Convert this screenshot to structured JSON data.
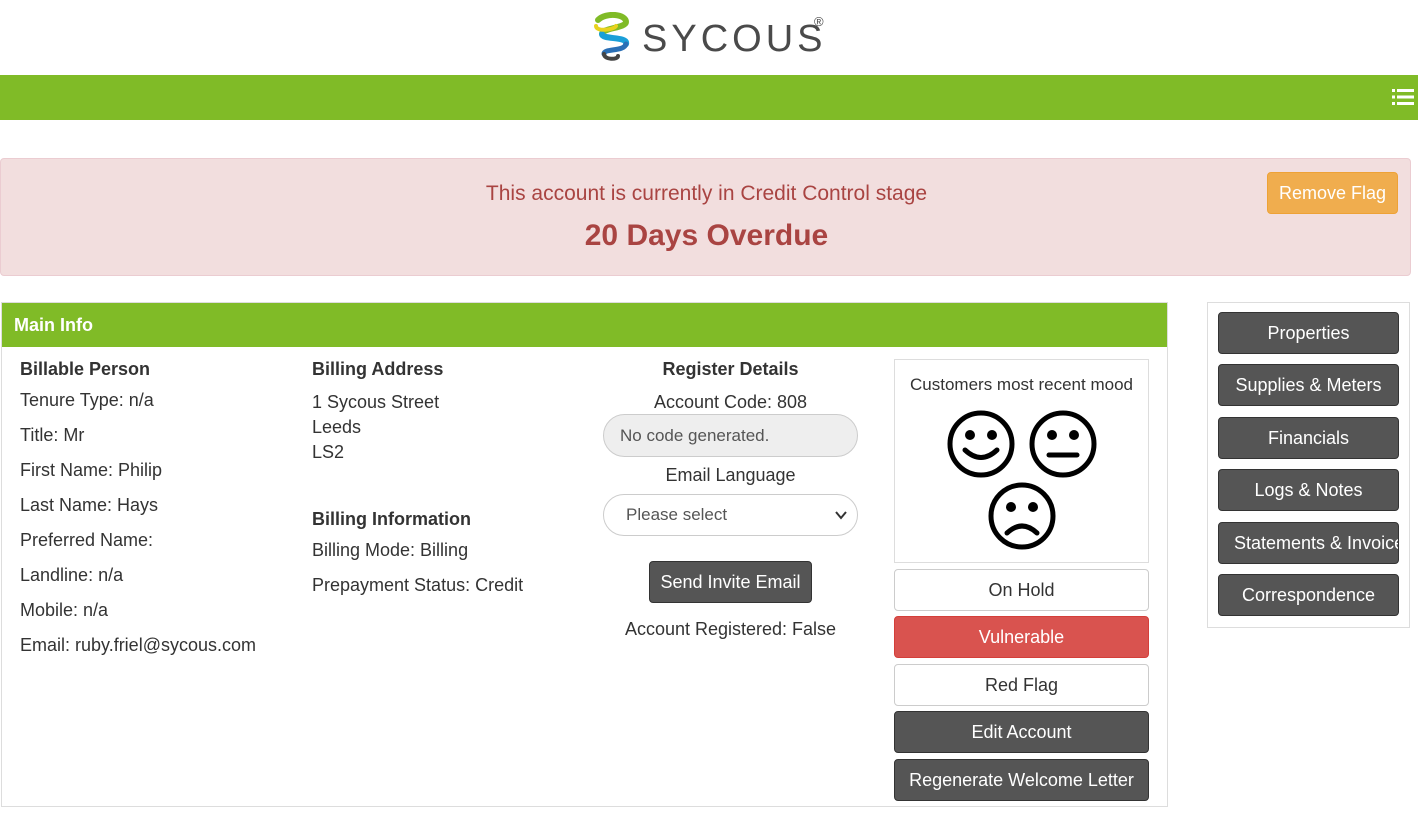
{
  "header": {
    "brand": "SYCOUS",
    "reg": "®",
    "brand_colors": {
      "navbar": "#80bb27"
    },
    "menu_icon": "list-icon"
  },
  "alert": {
    "subtitle": "This account is currently in Credit Control stage",
    "title": "20 Days Overdue",
    "remove_flag_label": "Remove Flag"
  },
  "main_info": {
    "heading": "Main Info",
    "billable_person": {
      "heading": "Billable Person",
      "rows": [
        "Tenure Type: n/a",
        "Title: Mr",
        "First Name: Philip",
        "Last Name: Hays",
        "Preferred Name:",
        "Landline: n/a",
        "Mobile: n/a",
        "Email: ruby.friel@sycous.com"
      ]
    },
    "billing_address": {
      "heading": "Billing Address",
      "lines": [
        "1 Sycous Street",
        "Leeds",
        "LS2"
      ]
    },
    "billing_information": {
      "heading": "Billing Information",
      "rows": [
        "Billing Mode: Billing",
        "Prepayment Status: Credit"
      ]
    },
    "register_details": {
      "heading": "Register Details",
      "account_code": "Account Code: 808",
      "code_placeholder": "No code generated.",
      "email_language_label": "Email Language",
      "email_language_selected": "Please select",
      "send_invite_label": "Send Invite Email",
      "registered": "Account Registered: False"
    },
    "mood": {
      "title": "Customers most recent mood",
      "faces": [
        "happy-face-icon",
        "neutral-face-icon",
        "sad-face-icon"
      ]
    },
    "actions": {
      "on_hold": "On Hold",
      "vulnerable": "Vulnerable",
      "red_flag": "Red Flag",
      "edit_account": "Edit Account",
      "regenerate_letter": "Regenerate Welcome Letter"
    }
  },
  "sidebar": {
    "items": [
      {
        "label": "Properties"
      },
      {
        "label": "Supplies & Meters"
      },
      {
        "label": "Financials"
      },
      {
        "label": "Logs & Notes"
      },
      {
        "label": "Statements & Invoices"
      },
      {
        "label": "Correspondence"
      }
    ]
  }
}
